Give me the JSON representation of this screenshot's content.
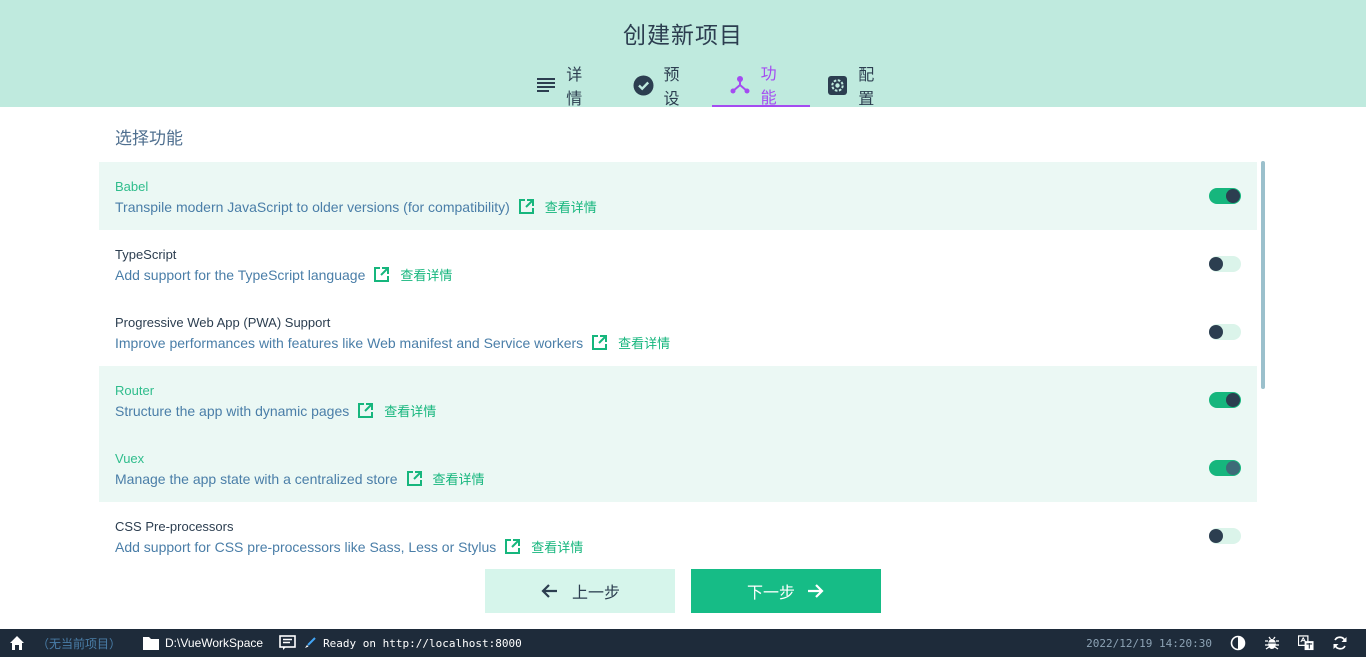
{
  "window": {
    "title": "创建新项目"
  },
  "tabs": [
    {
      "label": "详情",
      "icon": "subject-icon"
    },
    {
      "label": "预设",
      "icon": "check-circle-icon"
    },
    {
      "label": "功能",
      "icon": "device-hub-icon",
      "active": true
    },
    {
      "label": "配置",
      "icon": "settings-applications-icon"
    }
  ],
  "section_title": "选择功能",
  "features": [
    {
      "name": "Babel",
      "description": "Transpile modern JavaScript to older versions (for compatibility)",
      "more_label": "查看详情",
      "enabled": true
    },
    {
      "name": "TypeScript",
      "description": "Add support for the TypeScript language",
      "more_label": "查看详情",
      "enabled": false
    },
    {
      "name": "Progressive Web App (PWA) Support",
      "description": "Improve performances with features like Web manifest and Service workers",
      "more_label": "查看详情",
      "enabled": false
    },
    {
      "name": "Router",
      "description": "Structure the app with dynamic pages",
      "more_label": "查看详情",
      "enabled": true
    },
    {
      "name": "Vuex",
      "description": "Manage the app state with a centralized store",
      "more_label": "查看详情",
      "enabled": true
    },
    {
      "name": "CSS Pre-processors",
      "description": "Add support for CSS pre-processors like Sass, Less or Stylus",
      "more_label": "查看详情",
      "enabled": false
    }
  ],
  "buttons": {
    "prev_label": "上一步",
    "next_label": "下一步"
  },
  "statusbar": {
    "project": "（无当前项目）",
    "folder": "D:\\VueWorkSpace",
    "log": "Ready on http://localhost:8000",
    "time": "2022/12/19 14:20:30"
  },
  "colors": {
    "accent": "#16b67d",
    "active_tab": "#a44cf1",
    "header_bg": "#bfeade",
    "statusbar_bg": "#1e2b3a"
  }
}
